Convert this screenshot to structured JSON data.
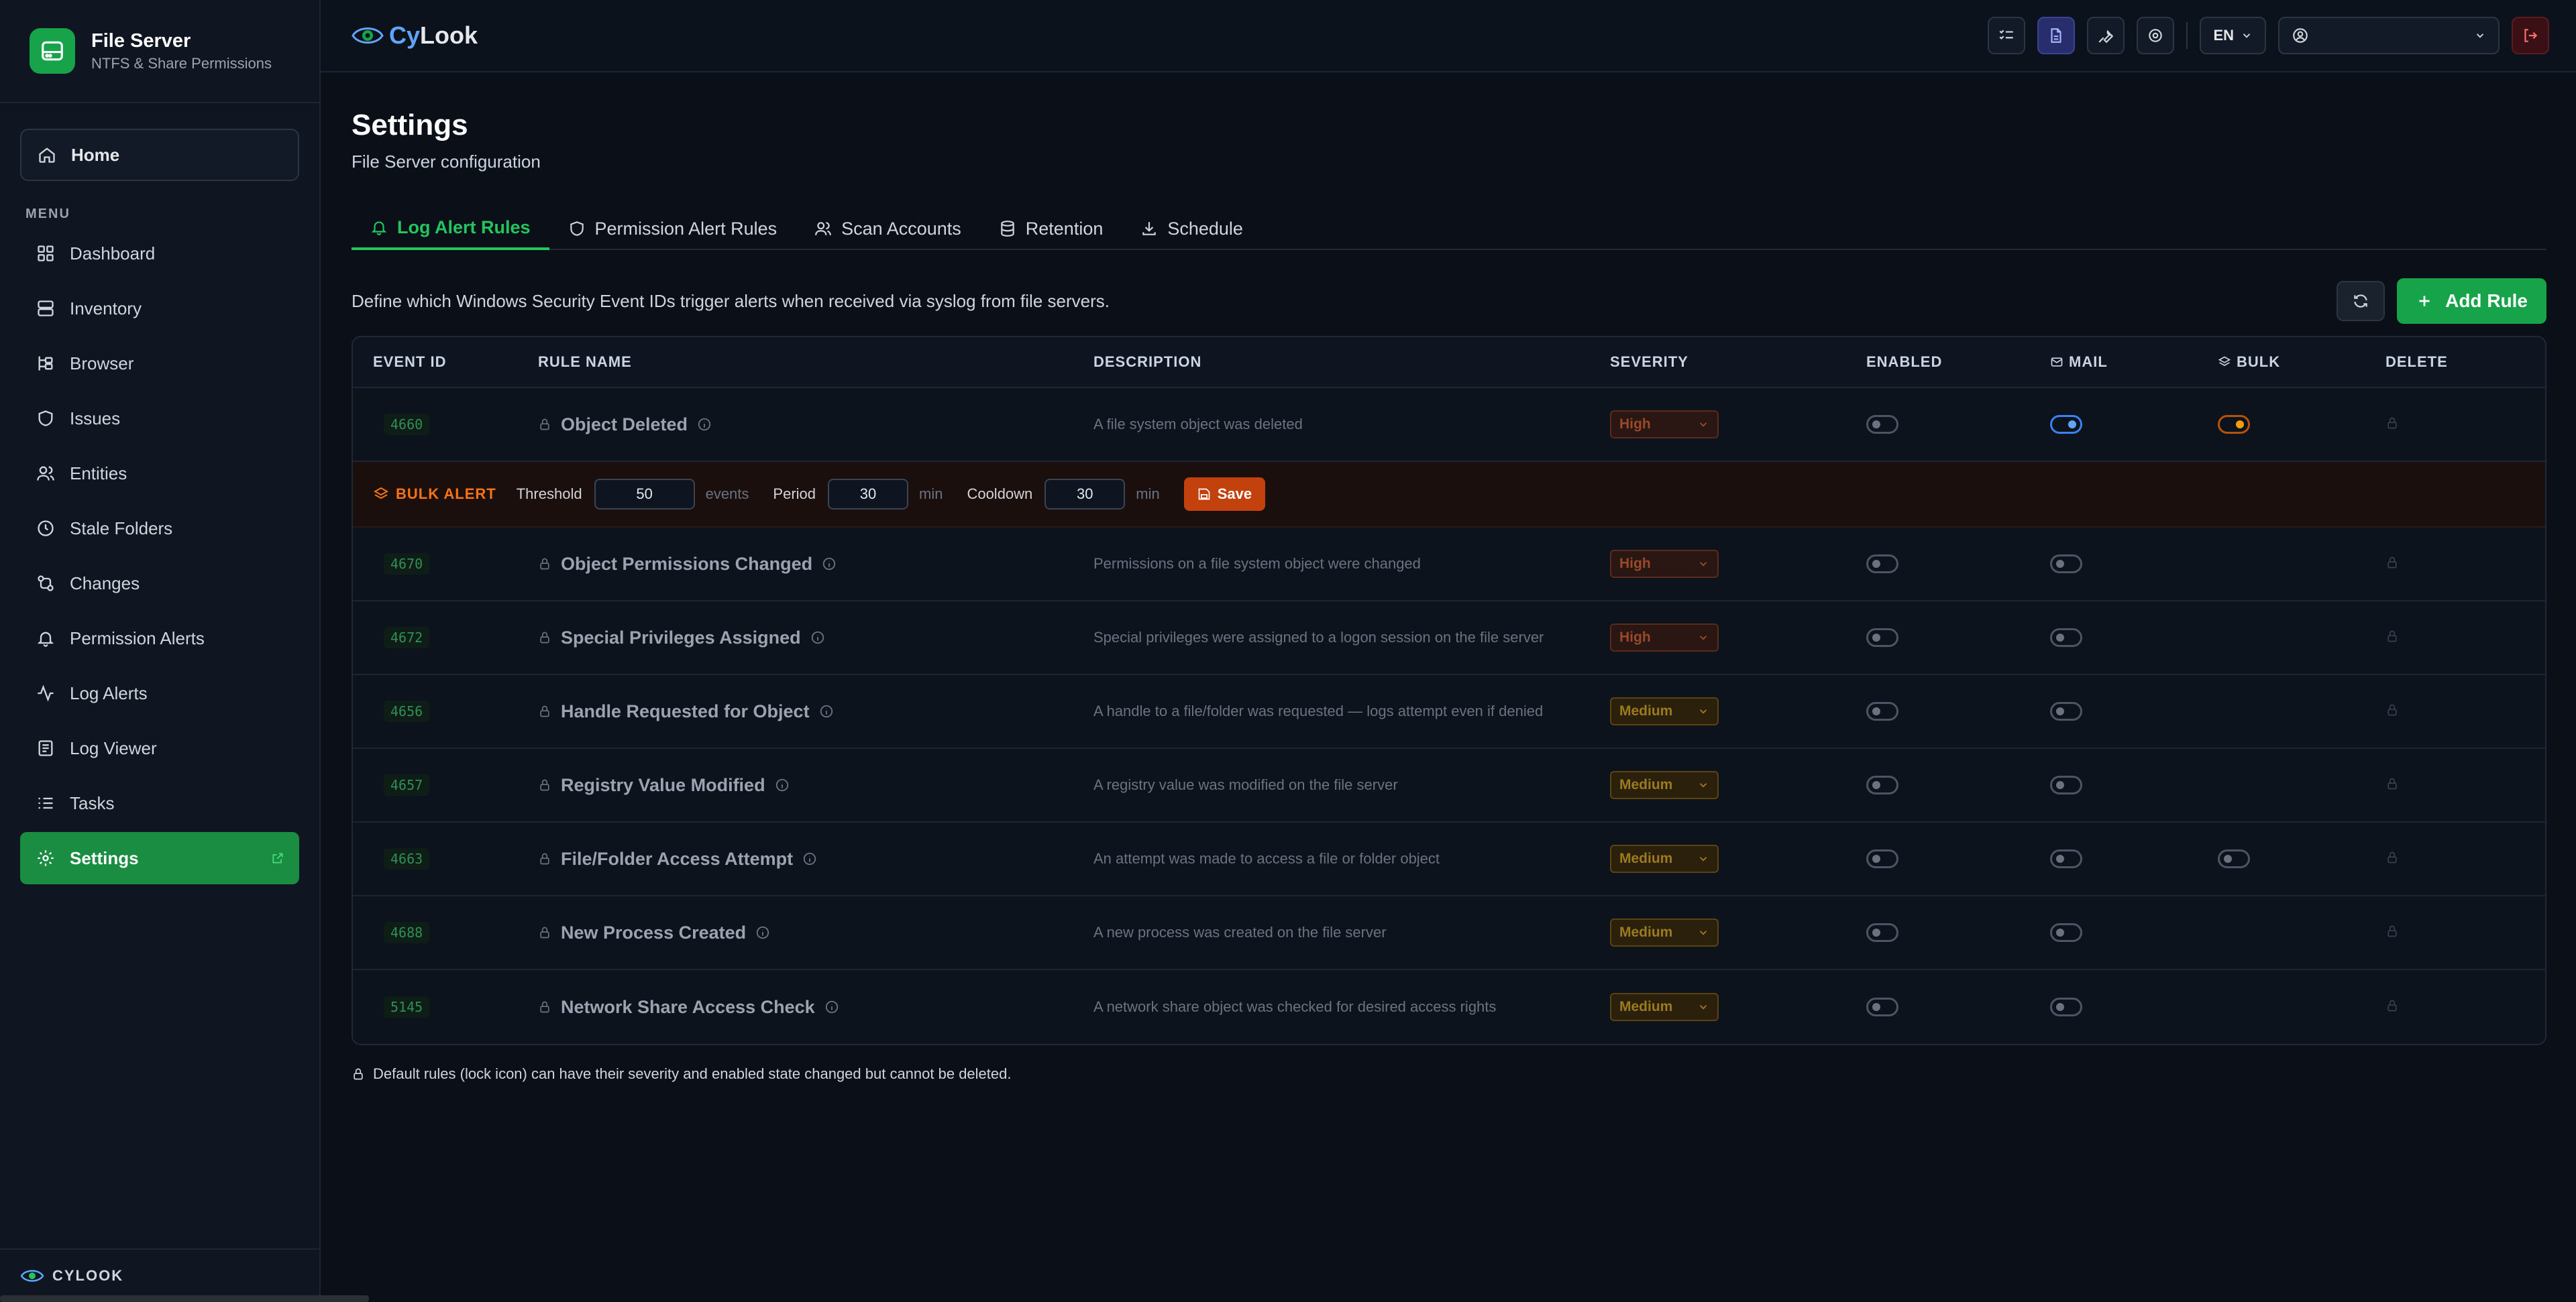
{
  "brand": {
    "title": "File Server",
    "subtitle": "NTFS & Share Permissions"
  },
  "sidebar": {
    "home": "Home",
    "menu_heading": "MENU",
    "items": [
      {
        "label": "Dashboard",
        "icon": "dashboard-icon"
      },
      {
        "label": "Inventory",
        "icon": "server-icon"
      },
      {
        "label": "Browser",
        "icon": "tree-icon"
      },
      {
        "label": "Issues",
        "icon": "shield-icon"
      },
      {
        "label": "Entities",
        "icon": "users-icon"
      },
      {
        "label": "Stale Folders",
        "icon": "clock-icon"
      },
      {
        "label": "Changes",
        "icon": "git-compare-icon"
      },
      {
        "label": "Permission Alerts",
        "icon": "bell-icon"
      },
      {
        "label": "Log Alerts",
        "icon": "activity-icon"
      },
      {
        "label": "Log Viewer",
        "icon": "log-icon"
      },
      {
        "label": "Tasks",
        "icon": "list-checks-icon"
      },
      {
        "label": "Settings",
        "icon": "gear-icon",
        "active": true
      }
    ],
    "footer": "CYLOOK"
  },
  "topbar": {
    "logo_cy": "Cy",
    "logo_look": "Look",
    "lang": "EN"
  },
  "page": {
    "title": "Settings",
    "subtitle": "File Server configuration"
  },
  "tabs": [
    {
      "label": "Log Alert Rules",
      "active": true
    },
    {
      "label": "Permission Alert Rules"
    },
    {
      "label": "Scan Accounts"
    },
    {
      "label": "Retention"
    },
    {
      "label": "Schedule"
    }
  ],
  "description": "Define which Windows Security Event IDs trigger alerts when received via syslog from file servers.",
  "add_rule_label": "Add Rule",
  "table": {
    "headers": [
      "EVENT ID",
      "RULE NAME",
      "DESCRIPTION",
      "SEVERITY",
      "ENABLED",
      "MAIL",
      "BULK",
      "DELETE"
    ],
    "rows": [
      {
        "id": "4660",
        "name": "Object Deleted",
        "desc": "A file system object was deleted",
        "severity": "High",
        "mail": "on",
        "bulk": "on"
      },
      {
        "id": "4670",
        "name": "Object Permissions Changed",
        "desc": "Permissions on a file system object were changed",
        "severity": "High",
        "mail": "off",
        "bulk": "none"
      },
      {
        "id": "4672",
        "name": "Special Privileges Assigned",
        "desc": "Special privileges were assigned to a logon session on the file server",
        "severity": "High",
        "mail": "off",
        "bulk": "none"
      },
      {
        "id": "4656",
        "name": "Handle Requested for Object",
        "desc": "A handle to a file/folder was requested — logs attempt even if denied",
        "severity": "Medium",
        "mail": "off",
        "bulk": "none"
      },
      {
        "id": "4657",
        "name": "Registry Value Modified",
        "desc": "A registry value was modified on the file server",
        "severity": "Medium",
        "mail": "off",
        "bulk": "none"
      },
      {
        "id": "4663",
        "name": "File/Folder Access Attempt",
        "desc": "An attempt was made to access a file or folder object",
        "severity": "Medium",
        "mail": "off",
        "bulk": "off"
      },
      {
        "id": "4688",
        "name": "New Process Created",
        "desc": "A new process was created on the file server",
        "severity": "Medium",
        "mail": "off",
        "bulk": "none"
      },
      {
        "id": "5145",
        "name": "Network Share Access Check",
        "desc": "A network share object was checked for desired access rights",
        "severity": "Medium",
        "mail": "off",
        "bulk": "none"
      }
    ]
  },
  "bulk_alert": {
    "label": "BULK ALERT",
    "threshold_label": "Threshold",
    "threshold": "50",
    "threshold_unit": "events",
    "period_label": "Period",
    "period": "30",
    "period_unit": "min",
    "cooldown_label": "Cooldown",
    "cooldown": "30",
    "cooldown_unit": "min",
    "save_label": "Save"
  },
  "footnote": "Default rules (lock icon) can have their severity and enabled state changed but cannot be deleted."
}
